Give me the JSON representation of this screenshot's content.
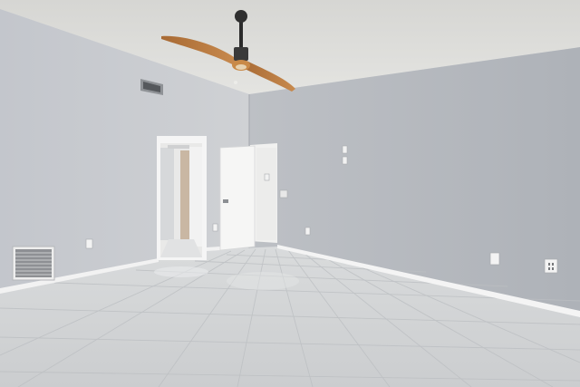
{
  "scene": {
    "kind": "interior-photo",
    "room": "empty bedroom",
    "colors": {
      "ceiling": "#d9d9d6",
      "left_wall": "#c4c7cc",
      "right_wall": "#b5b9bf",
      "floor": "#d2d4d6",
      "grout": "#b9bcbf",
      "baseboard": "#f2f2f2",
      "door": "#f4f4f4",
      "fan_blade": "#b7773e",
      "fan_body": "#2c2c2c",
      "vent": "#9a9ca0"
    },
    "objects": [
      {
        "name": "ceiling-fan",
        "icon": "ceiling-fan-icon"
      },
      {
        "name": "wall-vent-high",
        "icon": "vent-icon"
      },
      {
        "name": "floor-return-vent",
        "icon": "vent-icon"
      },
      {
        "name": "open-doorway",
        "icon": "doorway-icon"
      },
      {
        "name": "white-door",
        "icon": "door-icon"
      },
      {
        "name": "light-switches",
        "icon": "switch-icon"
      },
      {
        "name": "outlets",
        "icon": "outlet-icon"
      }
    ]
  }
}
